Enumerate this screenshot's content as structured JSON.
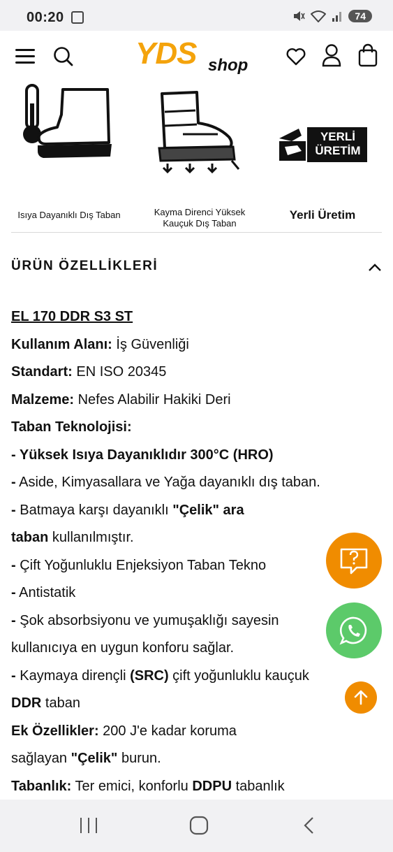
{
  "status": {
    "time": "00:20",
    "battery": "74"
  },
  "header": {
    "logo_main": "YDS",
    "logo_sub": "shop"
  },
  "features": [
    {
      "label_lines": [
        "Isıya Dayanıklı Dış Taban"
      ]
    },
    {
      "label_lines": [
        "Kayma Direnci Yüksek",
        "Kauçuk Dış Taban"
      ]
    },
    {
      "label_lines": [
        "Yerli Üretim"
      ],
      "badge_lines": [
        "YERLİ",
        "ÜRETİM"
      ]
    }
  ],
  "accordion": {
    "title": "ÜRÜN ÖZELLİKLERİ"
  },
  "specs": {
    "model": "EL 170 DDR S3 ST",
    "usage_label": "Kullanım Alanı:",
    "usage_value": " İş Güvenliği",
    "standard_label": "Standart:",
    "standard_value": " EN ISO 20345",
    "material_label": "Malzeme:",
    "material_value": " Nefes Alabilir Hakiki Deri",
    "sole_tech_label": "Taban Teknolojisi:",
    "line1": "- Yüksek Isıya Dayanıklıdır 300°C (HRO)",
    "line2_dash": "-",
    "line2_text": " Aside, Kimyasallara ve Yağa dayanıklı dış taban.",
    "line3_dash": "-",
    "line3_text": " Batmaya karşı dayanıklı ",
    "line3_bold": "\"Çelik\" ara",
    "line4_bold": "taban",
    "line4_text": " kullanılmıştır.",
    "line5_dash": "-",
    "line5_text": " Çift Yoğunluklu Enjeksiyon Taban Tekno",
    "line6_dash": "-",
    "line6_text": " Antistatik",
    "line7_dash": "-",
    "line7_text": " Şok absorbsiyonu ve yumuşaklığı sayesin",
    "line8_text": "kullanıcıya en uygun konforu sağlar.",
    "line9_dash": "-",
    "line9_text": " Kaymaya dirençli ",
    "line9_bold": "(SRC)",
    "line9_text2": " çift yoğunluklu kauçuk",
    "line10_bold": "DDR",
    "line10_text": " taban",
    "extra_label": "Ek Özellikler:",
    "extra_value": " 200 J'e kadar koruma",
    "line12_text": "sağlayan ",
    "line12_bold": "\"Çelik\"",
    "line12_text2": " burun.",
    "insole_label": "Tabanlık:",
    "insole_value": " Ter emici, konforlu ",
    "insole_bold": "DDPU",
    "insole_value2": " tabanlık"
  },
  "fabs": {
    "help_color": "#f08c00",
    "whatsapp_color": "#5cca6a",
    "scroll_color": "#f08c00"
  }
}
